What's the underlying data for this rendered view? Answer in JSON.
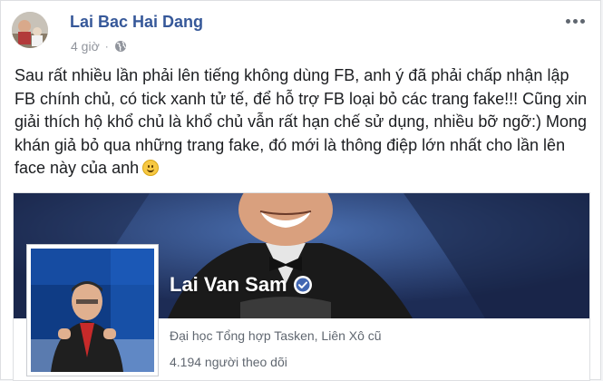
{
  "post": {
    "author": "Lai Bac Hai Dang",
    "time": "4 giờ",
    "time_separator": "·",
    "privacy_icon": "globe-icon",
    "more_icon": "more-options-icon",
    "text": "Sau rất nhiều lần phải lên tiếng không dùng FB, anh ý đã phải chấp nhận lập\nFB chính chủ, có tick xanh tử tế, để hỗ trợ FB loại bỏ các trang fake!!! Cũng xin\ngiải thích hộ khổ chủ là khổ chủ vẫn rất hạn chế sử dụng, nhiều bỡ ngỡ:) Mong\nkhán giả bỏ qua những trang fake, đó mới là thông điệp lớn nhất cho lần lên\nface này của anh",
    "emoji": "smile-emoji"
  },
  "shared_page": {
    "name": "Lai Van Sam",
    "verified_icon": "verified-badge-icon",
    "info": "Đại học Tổng hợp Tasken, Liên Xô cũ",
    "followers": "4.194 người theo dõi"
  },
  "colors": {
    "link_blue": "#365899",
    "meta_gray": "#90949c",
    "cover_blue": "#253f74",
    "verified_blue": "#4267b2"
  }
}
